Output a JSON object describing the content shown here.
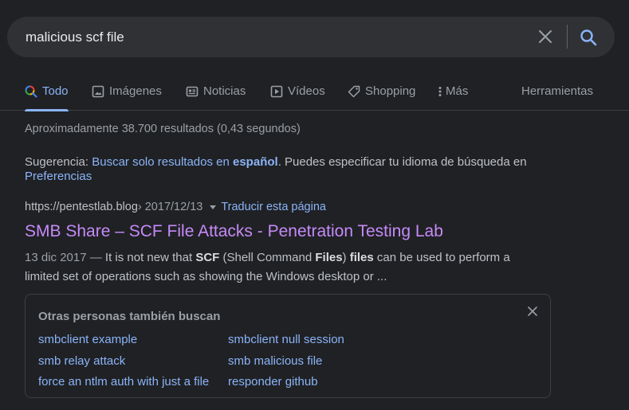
{
  "search": {
    "query": "malicious scf file"
  },
  "tabs": [
    {
      "label": "Todo",
      "icon": "search-color-icon",
      "active": true
    },
    {
      "label": "Imágenes",
      "icon": "image-icon"
    },
    {
      "label": "Noticias",
      "icon": "news-icon"
    },
    {
      "label": "Vídeos",
      "icon": "play-icon"
    },
    {
      "label": "Shopping",
      "icon": "tag-icon"
    },
    {
      "label": "Más",
      "icon": "more-vert-icon"
    }
  ],
  "tools_label": "Herramientas",
  "result_stats": "Aproximadamente 38.700 resultados (0,43 segundos)",
  "suggestion": {
    "prefix": "Sugerencia: ",
    "link_text_1": "Buscar solo resultados en ",
    "link_text_bold": "español",
    "suffix": ". Puedes especificar tu idioma de búsqueda en ",
    "prefs_link": "Preferencias"
  },
  "result": {
    "url_host": "https://pentestlab.blog",
    "url_path": " › 2017/12/13",
    "translate": "Traducir esta página",
    "title": "SMB Share – SCF File Attacks - Penetration Testing Lab",
    "date": "13 dic 2017 — ",
    "snippet_1": "It is not new that ",
    "snippet_b1": "SCF",
    "snippet_2": " (Shell Command ",
    "snippet_b2": "Files",
    "snippet_3": ") ",
    "snippet_b3": "files",
    "snippet_4": " can be used to perform a limited set of operations such as showing the Windows desktop or ..."
  },
  "people_also_search": {
    "title": "Otras personas también buscan",
    "links": [
      "smbclient example",
      "smbclient null session",
      "smb relay attack",
      "smb malicious file",
      "force an ntlm auth with just a file",
      "responder github"
    ]
  },
  "colors": {
    "background": "#202124",
    "link": "#8ab4f8",
    "visited": "#c58af9"
  }
}
